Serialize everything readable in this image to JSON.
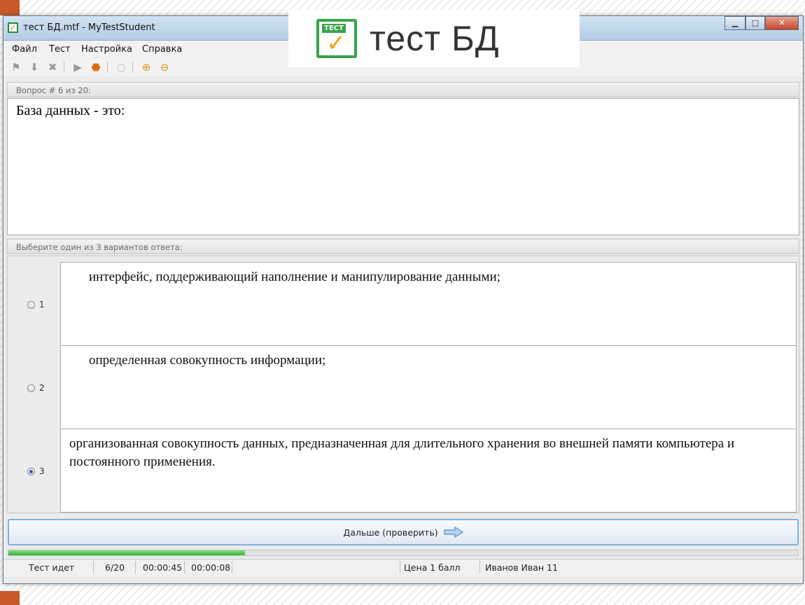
{
  "window": {
    "title": "тест БД.mtf - MyTestStudent",
    "buttons": {
      "minimize": "▁",
      "maximize": "□",
      "close": "✕"
    }
  },
  "logo": {
    "tag": "ТЕСТ",
    "text": "тест БД"
  },
  "menu": [
    "Файл",
    "Тест",
    "Настройка",
    "Справка"
  ],
  "toolbar": {
    "icons": [
      "flag-icon",
      "down-arrow-icon",
      "delete-icon",
      "play-icon",
      "stop-icon",
      "speech-icon",
      "zoom-in-icon",
      "zoom-out-icon"
    ]
  },
  "question": {
    "header": "Вопрос # 6 из 20:",
    "text": "База данных - это:"
  },
  "answers": {
    "header": "Выберите один из 3 вариантов ответа:",
    "options": [
      {
        "num": "1",
        "text": "интерфейс, поддерживающий наполнение и манипулирование данными;",
        "selected": false
      },
      {
        "num": "2",
        "text": "определенная совокупность информации;",
        "selected": false
      },
      {
        "num": "3",
        "text": "организованная совокупность данных, предназначенная для длительного хранения во внешней памяти компьютера и постоянного применения.",
        "selected": true
      }
    ]
  },
  "next_button": {
    "label": "Дальше (проверить)"
  },
  "progress": {
    "value": 0.3
  },
  "status": {
    "state": "Тест идет",
    "count": "6/20",
    "time_total": "00:00:45",
    "time_question": "00:00:08",
    "price": "Цена 1 балл",
    "user": "Иванов Иван 11"
  },
  "colors": {
    "accent": "#7fb0e0",
    "progress": "#33b533",
    "logo_green": "#39a24b",
    "logo_orange": "#f2a31a"
  }
}
